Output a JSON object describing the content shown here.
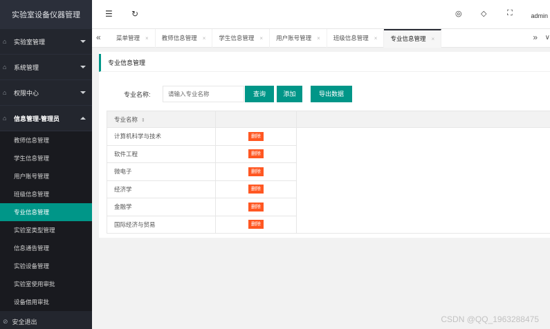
{
  "app_title": "实验室设备仪器管理",
  "sidebar": {
    "groups": [
      {
        "label": "实验室管理"
      },
      {
        "label": "系统管理"
      },
      {
        "label": "权限中心"
      },
      {
        "label": "信息管理-管理员"
      }
    ],
    "items": [
      {
        "label": "教师信息管理"
      },
      {
        "label": "学生信息管理"
      },
      {
        "label": "用户账号管理"
      },
      {
        "label": "班级信息管理"
      },
      {
        "label": "专业信息管理"
      },
      {
        "label": "实验室类型管理"
      },
      {
        "label": "信息通告管理"
      },
      {
        "label": "实验设备管理"
      },
      {
        "label": "实验室使用审批"
      },
      {
        "label": "设备借用审批"
      }
    ],
    "active_item": "专业信息管理",
    "logout": "安全退出"
  },
  "header": {
    "user": "admin",
    "icons": [
      "menu-fold-icon",
      "refresh-icon",
      "theme-icon",
      "tag-icon",
      "fullscreen-icon"
    ]
  },
  "tabs": [
    {
      "label": "菜单管理"
    },
    {
      "label": "教师信息管理"
    },
    {
      "label": "学生信息管理"
    },
    {
      "label": "用户账号管理"
    },
    {
      "label": "班级信息管理"
    },
    {
      "label": "专业信息管理"
    }
  ],
  "page": {
    "title": "专业信息管理",
    "search_label": "专业名称:",
    "search_placeholder": "请输入专业名称",
    "btn_query": "查询",
    "btn_add": "添加",
    "btn_export": "导出数据"
  },
  "table": {
    "column": "专业名称",
    "delete_label": "删除",
    "rows": [
      {
        "name": "计算机科学与技术"
      },
      {
        "name": "软件工程"
      },
      {
        "name": "微电子"
      },
      {
        "name": "经济学"
      },
      {
        "name": "金融学"
      },
      {
        "name": "国际经济与贸易"
      }
    ]
  },
  "watermark": "CSDN @QQ_1963288475",
  "colors": {
    "accent": "#009688",
    "danger": "#ff5722",
    "sidebar": "#23262e"
  }
}
